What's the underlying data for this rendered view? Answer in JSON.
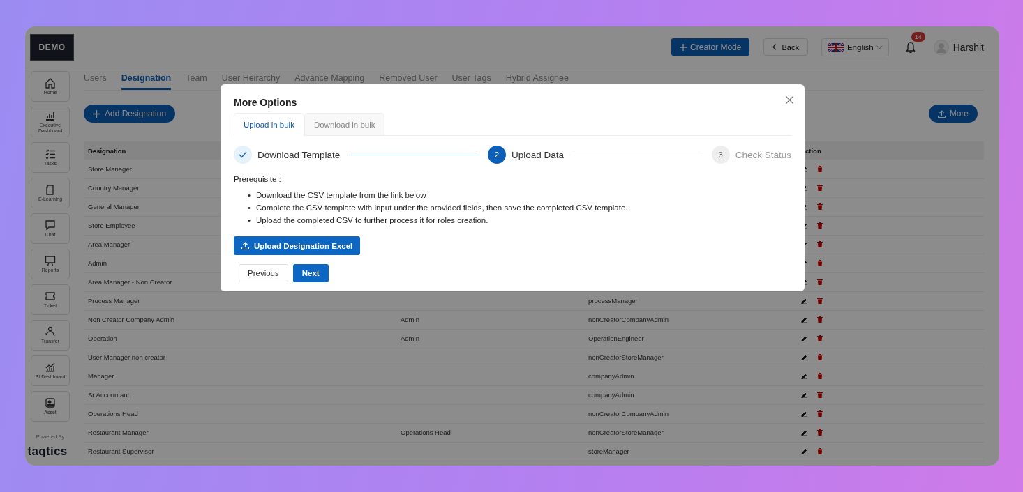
{
  "header": {
    "logo": "DEMO",
    "creator_button": "Creator Mode",
    "back_button": "Back",
    "language": "English",
    "notification_count": "14",
    "user_name": "Harshit"
  },
  "sidebar": {
    "items": [
      {
        "label": "Home"
      },
      {
        "label": "Executive Dashboard"
      },
      {
        "label": "Tasks"
      },
      {
        "label": "E-Learning"
      },
      {
        "label": "Chat"
      },
      {
        "label": "Reports"
      },
      {
        "label": "Ticket"
      },
      {
        "label": "Transfer"
      },
      {
        "label": "BI Dashboard"
      },
      {
        "label": "Asset"
      }
    ],
    "powered_by": "Powered By",
    "brand": "taqtics"
  },
  "tabs": [
    {
      "label": "Users",
      "selected": false
    },
    {
      "label": "Designation",
      "selected": true
    },
    {
      "label": "Team",
      "selected": false
    },
    {
      "label": "User Heirarchy",
      "selected": false
    },
    {
      "label": "Advance Mapping",
      "selected": false
    },
    {
      "label": "Removed User",
      "selected": false
    },
    {
      "label": "User Tags",
      "selected": false
    },
    {
      "label": "Hybrid Assignee",
      "selected": false
    }
  ],
  "add_button": "Add Designation",
  "more_button": "More",
  "table": {
    "columns": [
      "Designation",
      "ction"
    ],
    "rows": [
      {
        "designation": "Store Manager"
      },
      {
        "designation": "Country Manager"
      },
      {
        "designation": "General Manager"
      },
      {
        "designation": "Store Employee"
      },
      {
        "designation": "Area Manager"
      },
      {
        "designation": "Admin"
      },
      {
        "designation": "Area Manager - Non Creator"
      },
      {
        "designation": "Process Manager",
        "role": "processManager"
      },
      {
        "designation": "Non Creator Company Admin",
        "column_2": "Admin",
        "role": "nonCreatorCompanyAdmin"
      },
      {
        "designation": "Operation",
        "column_2": "Admin",
        "role": "OperationEngineer"
      },
      {
        "designation": "User Manager non creator",
        "role": "nonCreatorStoreManager"
      },
      {
        "designation": "Manager",
        "role": "companyAdmin"
      },
      {
        "designation": "Sr Accountant",
        "role": "companyAdmin"
      },
      {
        "designation": "Operations Head",
        "role": "nonCreatorCompanyAdmin"
      },
      {
        "designation": "Restaurant Manager",
        "column_2": "Operations Head",
        "role": "nonCreatorStoreManager"
      },
      {
        "designation": "Restaurant Supervisor",
        "role": "storeManager"
      }
    ]
  },
  "modal": {
    "title": "More Options",
    "tabs": [
      {
        "label": "Upload in bulk",
        "selected": true
      },
      {
        "label": "Download in bulk",
        "selected": false
      }
    ],
    "steps": [
      {
        "label": "Download Template",
        "completed": true,
        "current": false
      },
      {
        "number": "2",
        "label": "Upload Data",
        "completed": false,
        "current": true
      },
      {
        "number": "3",
        "label": "Check Status",
        "completed": false,
        "current": false
      }
    ],
    "prerequisite": "Prerequisite :",
    "bullets": [
      {
        "marker": "•",
        "text": "Download the CSV template from the link below"
      },
      {
        "marker": "•",
        "text": "Complete the CSV template with input under the provided fields, then save the completed CSV template."
      },
      {
        "marker": "•",
        "text": "Upload the completed CSV to further process it for roles creation."
      }
    ],
    "upload_button": "Upload Designation Excel",
    "previous_button": "Previous",
    "next_button": "Next"
  }
}
